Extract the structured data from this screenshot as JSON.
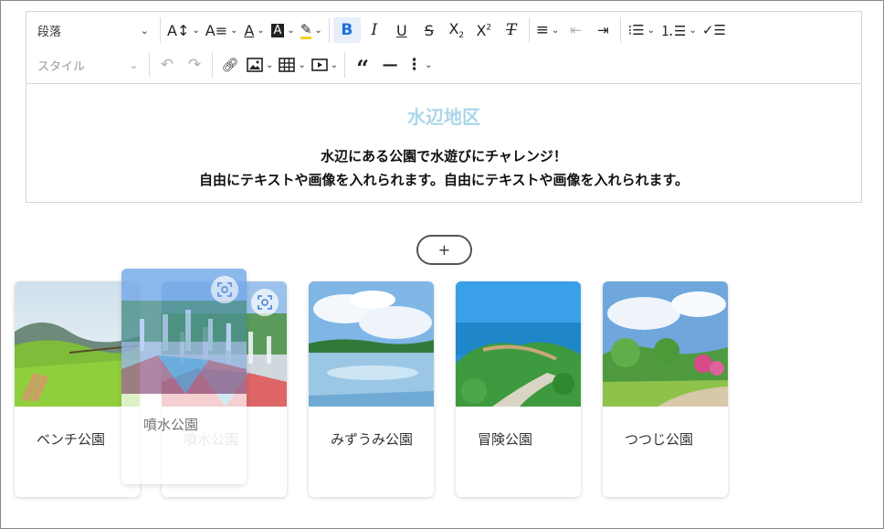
{
  "toolbar": {
    "paragraph_label": "段落",
    "style_label": "スタイル"
  },
  "content": {
    "title": "水辺地区",
    "line1": "水辺にある公園で水遊びにチャレンジ！",
    "line2": "自由にテキストや画像を入れられます。自由にテキストや画像を入れられます。"
  },
  "add_button": "+",
  "cards": [
    {
      "name": "ベンチ公園"
    },
    {
      "name": "噴水公園"
    },
    {
      "name": "みずうみ公園"
    },
    {
      "name": "冒険公園"
    },
    {
      "name": "つつじ公園"
    }
  ],
  "drag_ghost": {
    "name": "噴水公園"
  },
  "colors": {
    "title": "#a9d6ea",
    "active_bold": "#1e6fd9"
  }
}
